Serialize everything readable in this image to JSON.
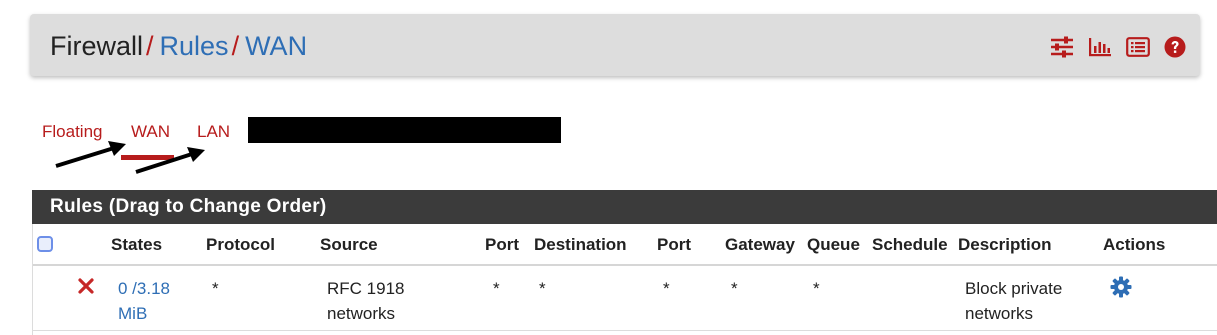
{
  "breadcrumb": {
    "root": "Firewall",
    "separator": "/",
    "items": [
      "Rules",
      "WAN"
    ]
  },
  "header_icons": [
    "sliders-icon",
    "bar-chart-icon",
    "list-icon",
    "help-icon"
  ],
  "tabs": [
    {
      "label": "Floating",
      "active": false
    },
    {
      "label": "WAN",
      "active": true
    },
    {
      "label": "LAN",
      "active": false
    }
  ],
  "panel": {
    "title": "Rules (Drag to Change Order)"
  },
  "table": {
    "columns": [
      "",
      "States",
      "Protocol",
      "Source",
      "Port",
      "Destination",
      "Port",
      "Gateway",
      "Queue",
      "Schedule",
      "Description",
      "Actions"
    ],
    "rows": [
      {
        "status_icon": "block-x-icon",
        "states_line1": "0 /3.18",
        "states_line2": "MiB",
        "protocol": "*",
        "source_line1": "RFC 1918",
        "source_line2": "networks",
        "source_port": "*",
        "destination": "*",
        "destination_port": "*",
        "gateway": "*",
        "queue": "*",
        "schedule": "",
        "description_line1": "Block private",
        "description_line2": "networks",
        "action_icon": "gear-icon"
      }
    ]
  },
  "colors": {
    "accent_red": "#b71c1c",
    "link_blue": "#2e6eb5",
    "panel_dark": "#3b3b3b",
    "header_bg": "#dddddd"
  }
}
